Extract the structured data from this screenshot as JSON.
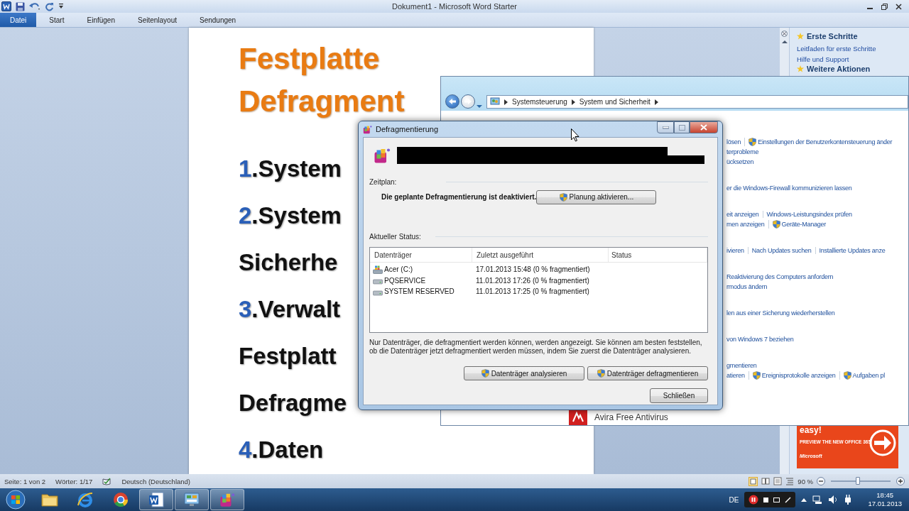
{
  "word": {
    "title": "Dokument1 - Microsoft Word Starter",
    "tabs": [
      {
        "label": "Datei",
        "selected": true
      },
      {
        "label": "Start",
        "selected": false
      },
      {
        "label": "Einfügen",
        "selected": false
      },
      {
        "label": "Seitenlayout",
        "selected": false
      },
      {
        "label": "Sendungen",
        "selected": false
      }
    ]
  },
  "document": {
    "lines": [
      {
        "kind": "heading",
        "text": "Festplatte"
      },
      {
        "kind": "heading",
        "text": "Defragment"
      },
      {
        "kind": "item",
        "number": "1",
        "text": ".System"
      },
      {
        "kind": "item",
        "number": "2",
        "text": ".System"
      },
      {
        "kind": "item",
        "text": "Sicherhe"
      },
      {
        "kind": "item",
        "number": "3",
        "text": ".Verwalt"
      },
      {
        "kind": "item",
        "text": "Festplatt"
      },
      {
        "kind": "item",
        "text": "Defragme"
      },
      {
        "kind": "item",
        "number": "4",
        "text": ".Daten"
      }
    ]
  },
  "task_pane": {
    "title": "Erste Schritte",
    "links": [
      "Leitfaden für erste Schritte",
      "Hilfe und Support"
    ],
    "next_title": "Weitere Aktionen",
    "ad": {
      "headline": "easy!",
      "cta": "PREVIEW THE NEW OFFICE 365",
      "brand": "Microsoft"
    }
  },
  "control_panel": {
    "breadcrumb": [
      "Systemsteuerung",
      "System und Sicherheit"
    ],
    "groups": [
      {
        "lines": [
          {
            "links": [
              {
                "text": "lösen",
                "shield": false
              },
              {
                "text": "Einstellungen der Benutzerkontensteuerung änder",
                "shield": true
              }
            ]
          },
          {
            "links": [
              {
                "text": "terprobleme",
                "shield": false
              }
            ]
          },
          {
            "links": [
              {
                "text": "ücksetzen",
                "shield": false
              }
            ]
          }
        ]
      },
      {
        "lines": [
          {
            "links": [
              {
                "text": "er die Windows-Firewall kommunizieren lassen",
                "shield": false
              }
            ]
          }
        ]
      },
      {
        "lines": [
          {
            "links": [
              {
                "text": "eit anzeigen",
                "shield": false
              },
              {
                "text": "Windows-Leistungsindex prüfen",
                "shield": false
              }
            ]
          },
          {
            "links": [
              {
                "text": "men anzeigen",
                "shield": false
              },
              {
                "text": "Geräte-Manager",
                "shield": true
              }
            ]
          }
        ]
      },
      {
        "lines": [
          {
            "links": [
              {
                "text": "ivieren",
                "shield": false
              },
              {
                "text": "Nach Updates suchen",
                "shield": false
              },
              {
                "text": "Installierte Updates anze",
                "shield": false
              }
            ]
          }
        ]
      },
      {
        "lines": [
          {
            "links": [
              {
                "text": "Reaktivierung des Computers anfordern",
                "shield": false
              }
            ]
          },
          {
            "links": [
              {
                "text": "rmodus ändern",
                "shield": false
              }
            ]
          }
        ]
      },
      {
        "lines": [
          {
            "links": [
              {
                "text": "len aus einer Sicherung wiederherstellen",
                "shield": false
              }
            ]
          }
        ]
      },
      {
        "lines": [
          {
            "links": [
              {
                "text": "von Windows 7 beziehen",
                "shield": false
              }
            ]
          }
        ]
      },
      {
        "lines": [
          {
            "links": [
              {
                "text": "gmentieren",
                "shield": false
              }
            ]
          },
          {
            "links": [
              {
                "text": "atieren",
                "shield": false
              },
              {
                "text": "Ereignisprotokolle anzeigen",
                "shield": true
              },
              {
                "text": "Aufgaben pl",
                "shield": true
              }
            ]
          }
        ]
      }
    ],
    "avira": "Avira Free Antivirus"
  },
  "defrag_dialog": {
    "title": "Defragmentierung",
    "schedule_label": "Zeitplan:",
    "schedule_text": "Die geplante Defragmentierung ist deaktiviert.",
    "schedule_button": "Planung aktivieren...",
    "status_label": "Aktueller Status:",
    "columns": [
      "Datenträger",
      "Zuletzt ausgeführt",
      "Status"
    ],
    "rows": [
      {
        "kind": "system",
        "name": "Acer (C:)",
        "last_run": "17.01.2013 15:48 (0 % fragmentiert)"
      },
      {
        "kind": "drive",
        "name": "PQSERVICE",
        "last_run": "11.01.2013 17:26 (0 % fragmentiert)"
      },
      {
        "kind": "drive",
        "name": "SYSTEM RESERVED",
        "last_run": "11.01.2013 17:25 (0 % fragmentiert)"
      }
    ],
    "note": "Nur Datenträger, die defragmentiert werden können, werden angezeigt. Sie können am besten feststellen, ob die Datenträger jetzt defragmentiert werden müssen, indem Sie zuerst die Datenträger analysieren.",
    "buttons": [
      "Datenträger analysieren",
      "Datenträger defragmentieren"
    ],
    "close_button": "Schließen"
  },
  "status_bar": {
    "page": "Seite: 1 von 2",
    "words": "Wörter: 1/17",
    "language": "Deutsch (Deutschland)",
    "zoom": "90 %",
    "zoom_slider": {
      "level": 0.45
    }
  },
  "taskbar": {
    "apps": [
      {
        "kind": "explorer",
        "running": false
      },
      {
        "kind": "ie",
        "running": false
      },
      {
        "kind": "chrome",
        "running": false
      },
      {
        "kind": "word",
        "running": true
      },
      {
        "kind": "control_panel",
        "running": true
      },
      {
        "kind": "defrag",
        "running": true
      }
    ],
    "input_language": "DE",
    "time": "18:45",
    "date": "17.01.2013"
  }
}
